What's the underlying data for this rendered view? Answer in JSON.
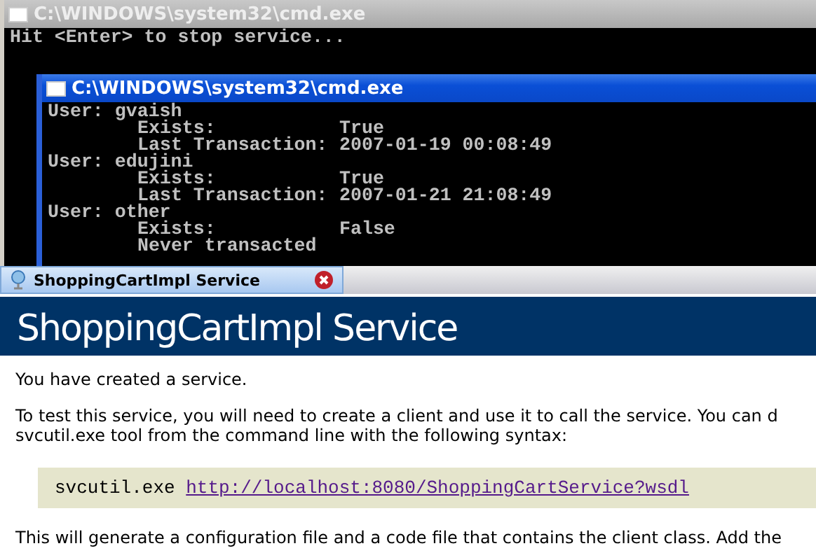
{
  "back_console": {
    "title": "C:\\WINDOWS\\system32\\cmd.exe",
    "active": false,
    "lines": [
      "Hit <Enter> to stop service..."
    ]
  },
  "front_console": {
    "title": "C:\\WINDOWS\\system32\\cmd.exe",
    "active": true,
    "users": [
      {
        "user": "User: gvaish",
        "fields": [
          {
            "label": "Exists:",
            "value": "True"
          },
          {
            "label": "Last Transaction:",
            "value": "2007-01-19 00:08:49"
          }
        ]
      },
      {
        "user": "User: edujini",
        "fields": [
          {
            "label": "Exists:",
            "value": "True"
          },
          {
            "label": "Last Transaction:",
            "value": "2007-01-21 21:08:49"
          }
        ]
      },
      {
        "user": "User: other",
        "fields": [
          {
            "label": "Exists:",
            "value": "False"
          },
          {
            "label": "Never transacted"
          }
        ]
      }
    ]
  },
  "browser": {
    "tabs": [
      {
        "title": "ShoppingCartImpl Service",
        "selected": true
      }
    ],
    "heading": "ShoppingCartImpl Service",
    "paragraphs": [
      {
        "lines": [
          "You have created a service."
        ]
      },
      {
        "lines": [
          "To test this service, you will need to create a client and use it to call the service. You can d",
          "svcutil.exe tool from the command line with the following syntax:"
        ]
      }
    ],
    "code": {
      "command": "svcutil.exe",
      "link": "http://localhost:8080/ShoppingCartService?wsdl"
    },
    "after_code": "This will generate a configuration file and a code file that contains the client class. Add the"
  }
}
